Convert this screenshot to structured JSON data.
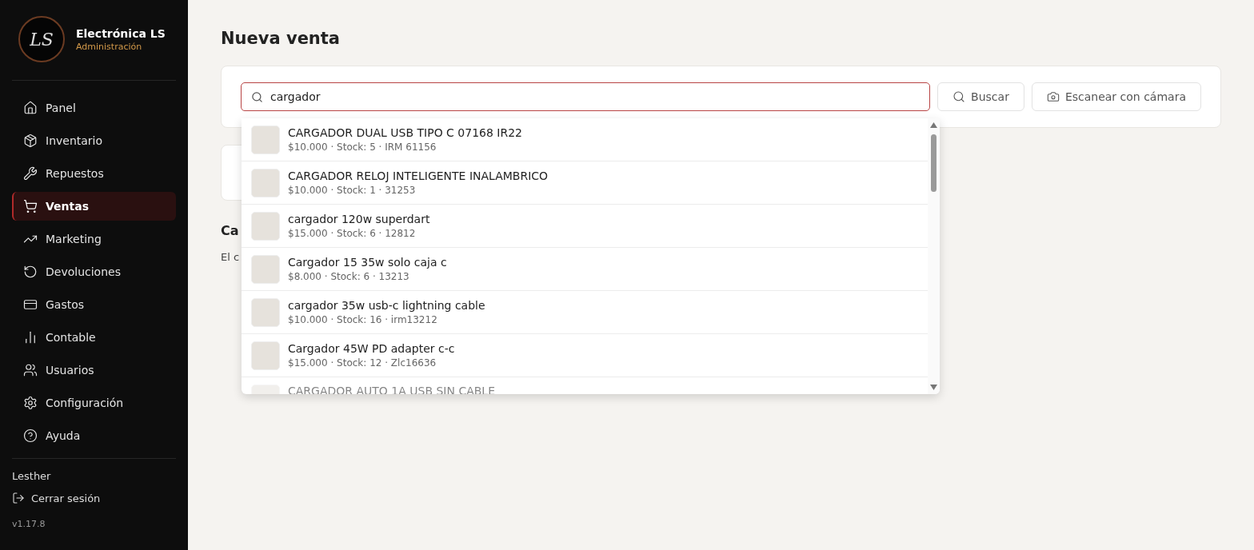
{
  "sidebar": {
    "brand": {
      "logo_text": "LS",
      "name": "Electrónica LS",
      "subtitle": "Administración"
    },
    "items": [
      {
        "label": "Panel",
        "selected": false
      },
      {
        "label": "Inventario",
        "selected": false
      },
      {
        "label": "Repuestos",
        "selected": false
      },
      {
        "label": "Ventas",
        "selected": true
      },
      {
        "label": "Marketing",
        "selected": false
      },
      {
        "label": "Devoluciones",
        "selected": false
      },
      {
        "label": "Gastos",
        "selected": false
      },
      {
        "label": "Contable",
        "selected": false
      },
      {
        "label": "Usuarios",
        "selected": false
      },
      {
        "label": "Configuración",
        "selected": false
      },
      {
        "label": "Ayuda",
        "selected": false
      }
    ],
    "user": "Lesther",
    "logout": "Cerrar sesión",
    "version": "v1.17.8"
  },
  "page_title": "Nueva venta",
  "search": {
    "value": "cargador",
    "buttons": [
      "Buscar",
      "Escanear con cámara"
    ]
  },
  "results": [
    {
      "name": "CARGADOR DUAL USB TIPO C 07168 IR22",
      "details": "$10.000 · Stock: 5 · IRM 61156"
    },
    {
      "name": "CARGADOR RELOJ INTELIGENTE INALAMBRICO",
      "details": "$10.000 · Stock: 1 · 31253"
    },
    {
      "name": "cargador 120w superdart",
      "details": "$15.000 · Stock: 6 · 12812"
    },
    {
      "name": "Cargador 15 35w solo caja c",
      "details": "$8.000 · Stock: 6 · 13213"
    },
    {
      "name": "cargador 35w usb-c lightning cable",
      "details": "$10.000 · Stock: 16 · irm13212"
    },
    {
      "name": "Cargador 45W PD adapter c-c",
      "details": "$15.000 · Stock: 12 · Zlc16636"
    },
    {
      "name": "CARGADOR AUTO 1A USB SIN CABLE"
    }
  ],
  "cart_section": {
    "heading": "Ca",
    "text": "El c"
  }
}
